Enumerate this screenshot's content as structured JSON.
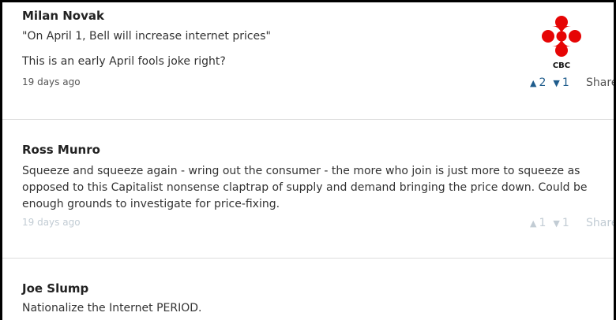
{
  "comments": [
    {
      "author": "Milan Novak",
      "lines": [
        "\"On April 1, Bell will increase internet prices\"",
        "This is an early April fools joke right?"
      ],
      "time": "19 days ago",
      "upvotes": "2",
      "downvotes": "1",
      "share_label": "Share"
    },
    {
      "author": "Ross Munro",
      "lines": [
        "Squeeze and squeeze again - wring out the consumer - the more who join is just more to squeeze as",
        "opposed to this Capitalist nonsense claptrap of supply and demand bringing the price down. Could be",
        "enough grounds to investigate for price-fixing."
      ],
      "time": "19 days ago",
      "upvotes": "1",
      "downvotes": "1",
      "share_label": "Share"
    },
    {
      "author": "Joe Slump",
      "lines": [
        "Nationalize the Internet PERIOD."
      ]
    }
  ],
  "logo": {
    "text": "CBC",
    "color": "#e60505"
  },
  "colors": {
    "vote_active": "#1f5c8c",
    "vote_faded": "#c2ccd4",
    "divider": "#dddddd"
  }
}
